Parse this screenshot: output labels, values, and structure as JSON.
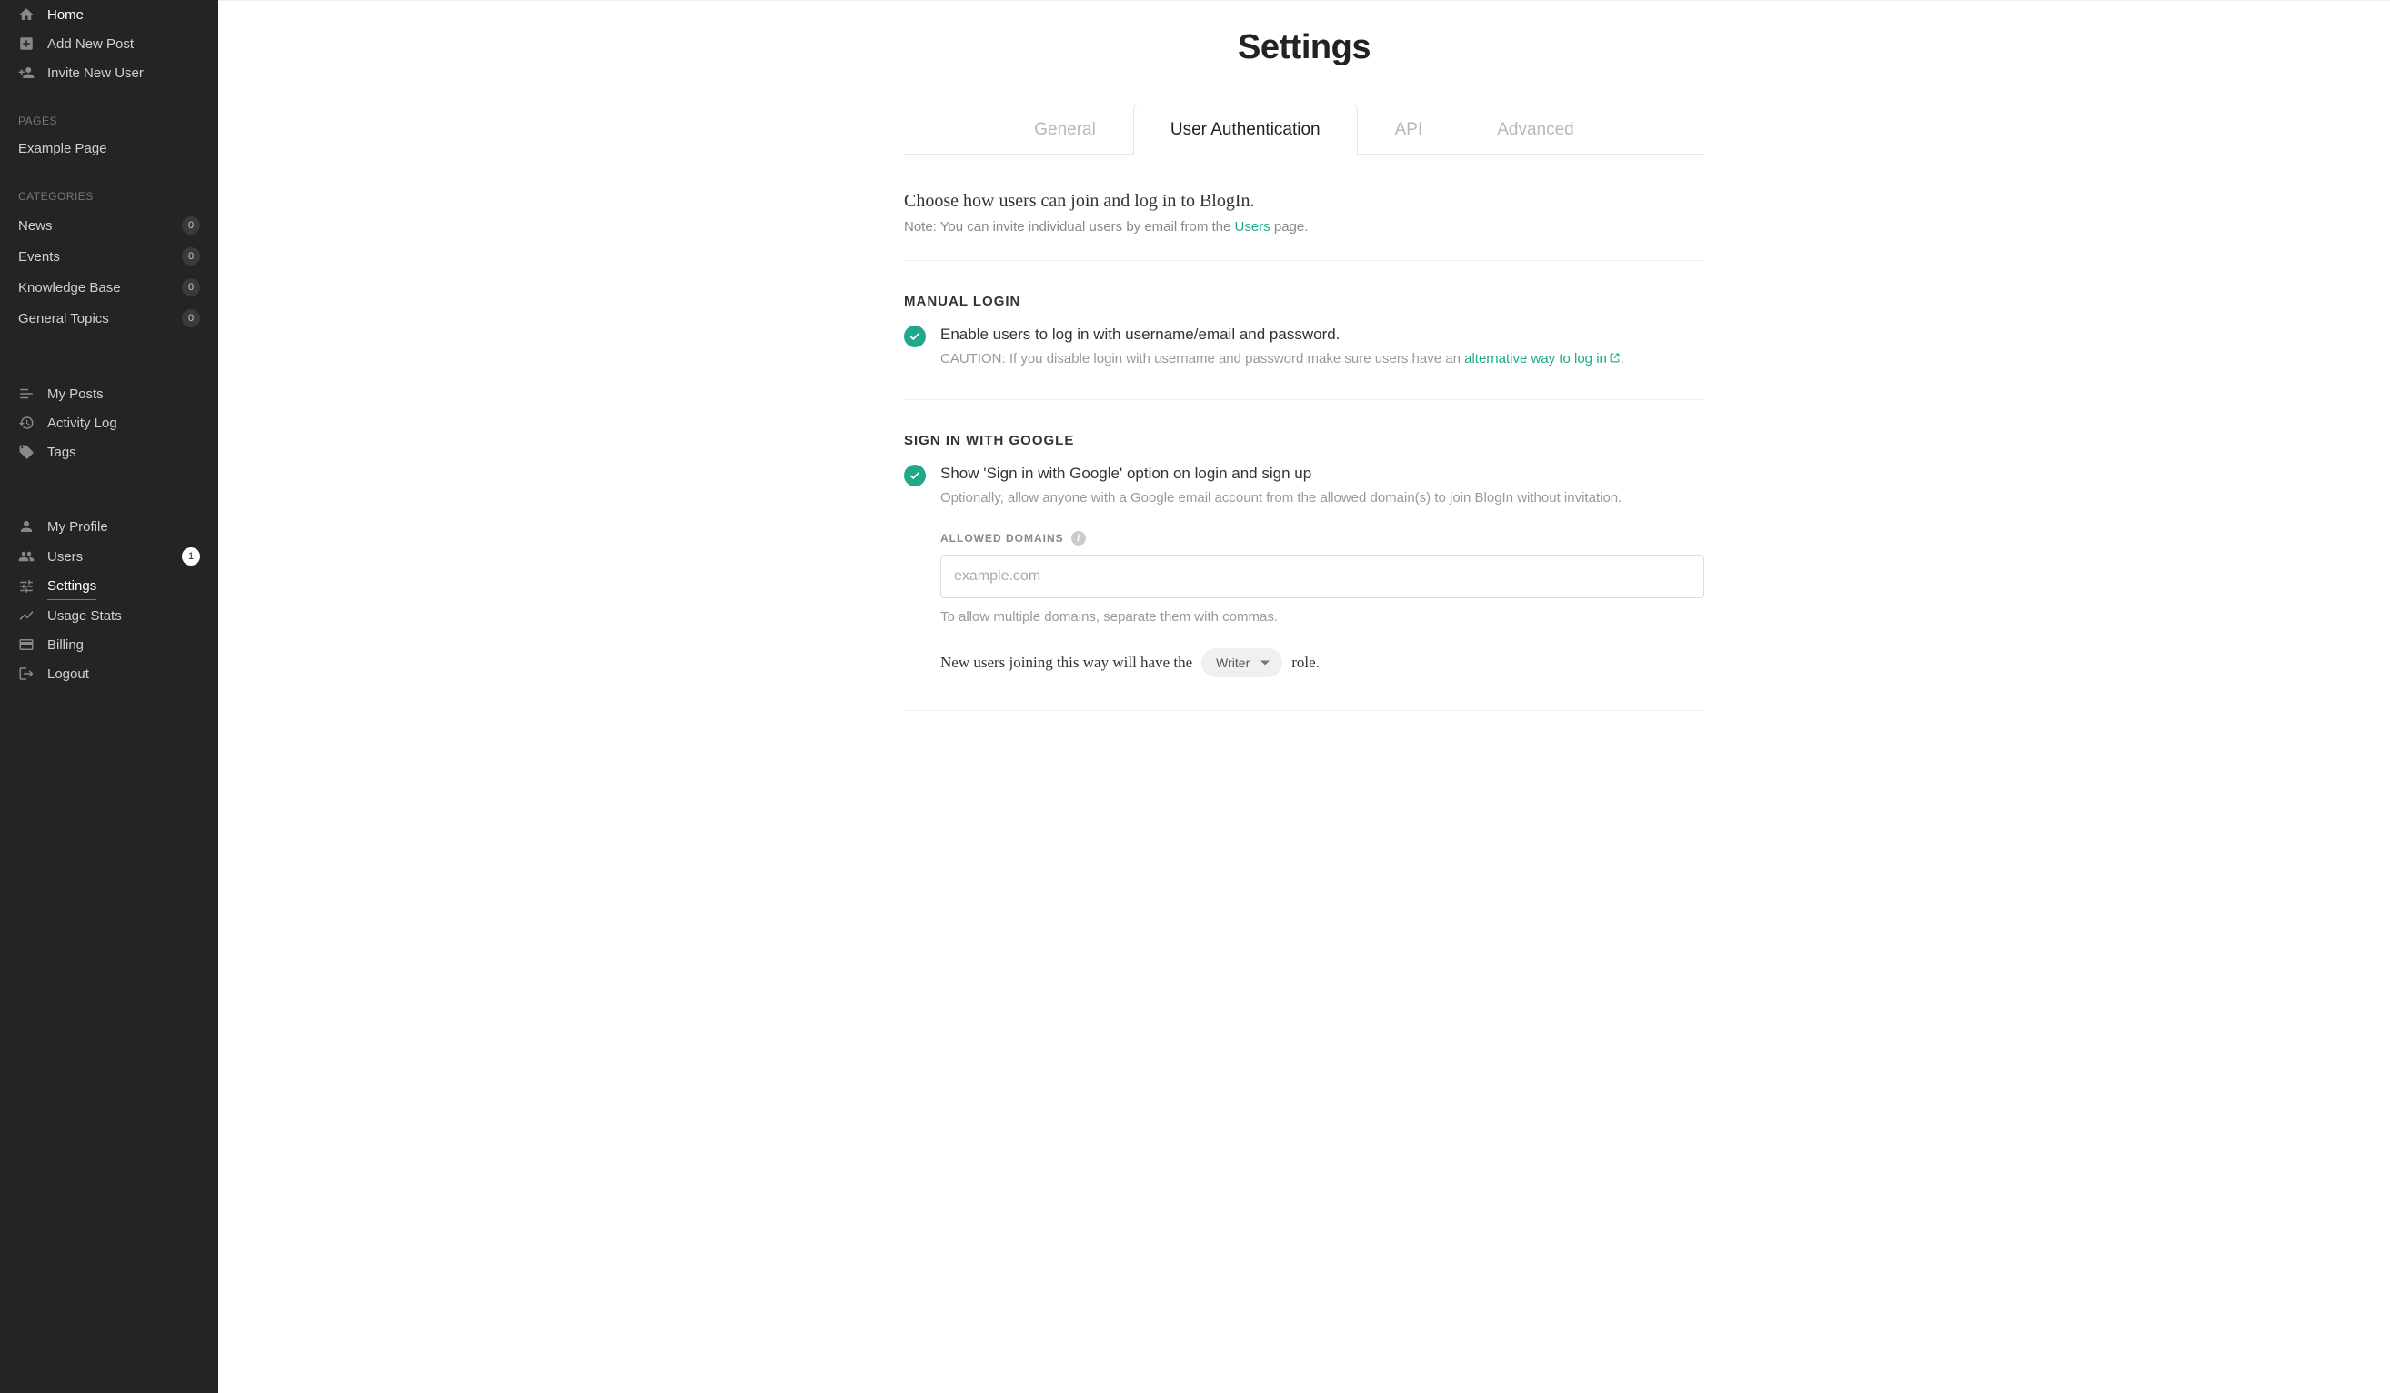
{
  "sidebar": {
    "top": [
      {
        "icon": "home",
        "label": "Home"
      },
      {
        "icon": "post",
        "label": "Add New Post"
      },
      {
        "icon": "invite",
        "label": "Invite New User"
      }
    ],
    "pages_label": "PAGES",
    "pages": [
      {
        "label": "Example Page"
      }
    ],
    "categories_label": "CATEGORIES",
    "categories": [
      {
        "label": "News",
        "count": "0"
      },
      {
        "label": "Events",
        "count": "0"
      },
      {
        "label": "Knowledge Base",
        "count": "0"
      },
      {
        "label": "General Topics",
        "count": "0"
      }
    ],
    "mid": [
      {
        "icon": "list",
        "label": "My Posts"
      },
      {
        "icon": "history",
        "label": "Activity Log"
      },
      {
        "icon": "tag",
        "label": "Tags"
      }
    ],
    "bottom": [
      {
        "icon": "person",
        "label": "My Profile",
        "badge": null
      },
      {
        "icon": "people",
        "label": "Users",
        "badge": "1"
      },
      {
        "icon": "sliders",
        "label": "Settings",
        "active": true
      },
      {
        "icon": "trend",
        "label": "Usage Stats"
      },
      {
        "icon": "card",
        "label": "Billing"
      },
      {
        "icon": "logout",
        "label": "Logout"
      }
    ]
  },
  "page": {
    "title": "Settings",
    "tabs": [
      "General",
      "User Authentication",
      "API",
      "Advanced"
    ],
    "active_tab": "User Authentication",
    "intro_heading": "Choose how users can join and log in to BlogIn.",
    "intro_note_prefix": "Note: You can invite individual users by email from the ",
    "intro_note_link": "Users",
    "intro_note_suffix": " page.",
    "manual_login": {
      "heading": "MANUAL LOGIN",
      "label": "Enable users to log in with username/email and password.",
      "caution_prefix": "CAUTION: If you disable login with username and password make sure users have an ",
      "caution_link": "alternative way to log in",
      "caution_suffix": "."
    },
    "google": {
      "heading": "SIGN IN WITH GOOGLE",
      "label": "Show 'Sign in with Google' option on login and sign up",
      "sub": "Optionally, allow anyone with a Google email account from the allowed domain(s) to join BlogIn without invitation.",
      "domains_label": "ALLOWED DOMAINS",
      "domains_placeholder": "example.com",
      "domains_help": "To allow multiple domains, separate them with commas.",
      "role_prefix": "New users joining this way will have the",
      "role_value": "Writer",
      "role_suffix": "role."
    }
  }
}
